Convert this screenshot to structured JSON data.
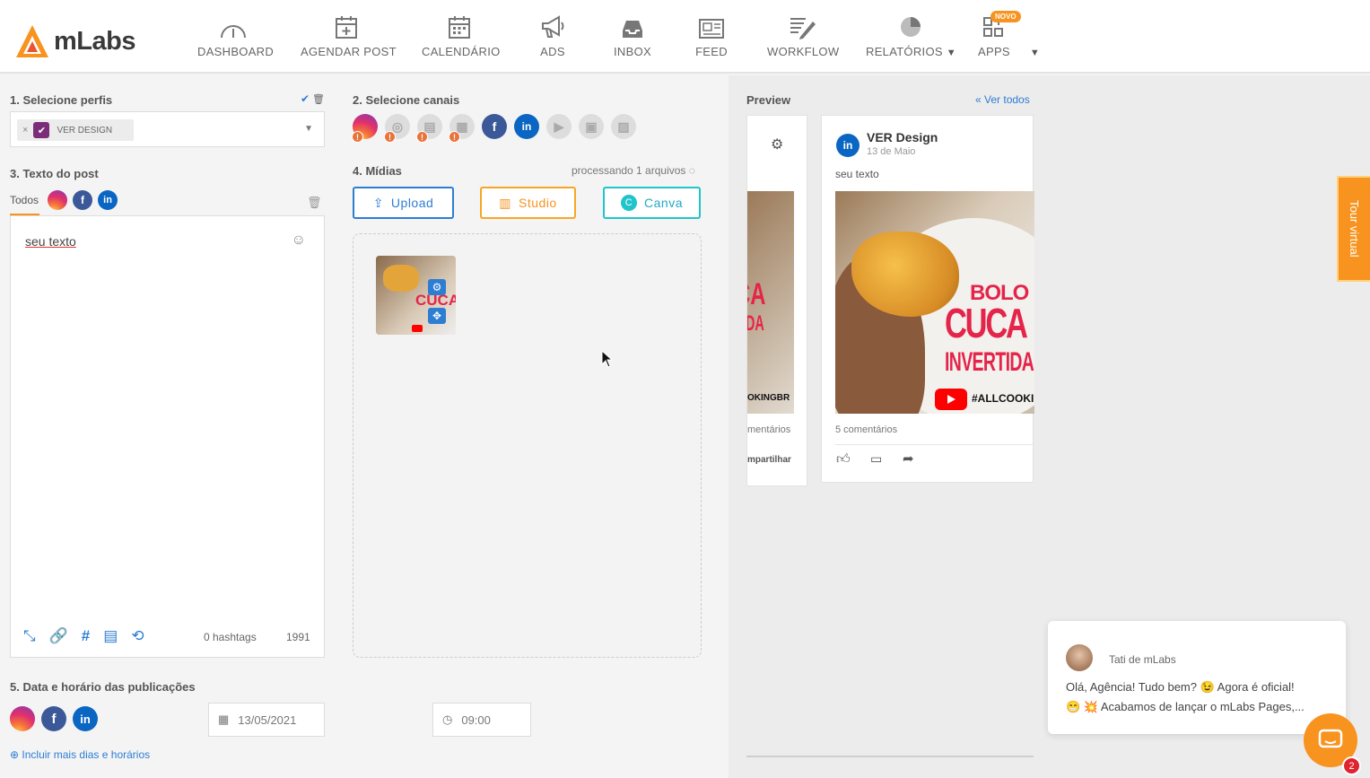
{
  "app": {
    "brand": "mLabs",
    "accent": "#f7931e",
    "link_color": "#2d7dd2"
  },
  "nav": [
    {
      "label": "DASHBOARD",
      "icon": "gauge-icon"
    },
    {
      "label": "AGENDAR POST",
      "icon": "calendar-plus-icon"
    },
    {
      "label": "CALENDÁRIO",
      "icon": "calendar-icon"
    },
    {
      "label": "ADS",
      "icon": "megaphone-icon"
    },
    {
      "label": "INBOX",
      "icon": "inbox-icon"
    },
    {
      "label": "FEED",
      "icon": "feed-icon"
    },
    {
      "label": "WORKFLOW",
      "icon": "workflow-icon"
    },
    {
      "label": "RELATÓRIOS",
      "icon": "pie-chart-icon"
    },
    {
      "label": "APPS",
      "icon": "apps-icon",
      "badge": "NOVO"
    }
  ],
  "profiles": {
    "title": "1. Selecione perfis",
    "selected": "VER DESIGN"
  },
  "post_text": {
    "title": "3. Texto do post",
    "tab_all": "Todos",
    "value": "seu texto",
    "hashtags": "0 hashtags",
    "char_count": "1991"
  },
  "channels": {
    "title": "2. Selecione canais",
    "list": [
      "instagram",
      "instagram-stories",
      "google-my-business",
      "pinterest",
      "facebook",
      "linkedin",
      "youtube",
      "tiktok",
      "image"
    ]
  },
  "media": {
    "title": "4. Mídias",
    "status": "processando 1 arquivos",
    "upload": "Upload",
    "studio": "Studio",
    "canva": "Canva"
  },
  "schedule": {
    "title": "5. Data e horário das publicações",
    "date": "13/05/2021",
    "time": "09:00",
    "add_more": "Incluir mais dias e horários"
  },
  "preview": {
    "title": "Preview",
    "see_all": "Ver todos",
    "page_name": "VER Design",
    "date": "13 de Maio",
    "text": "seu texto",
    "image_text": {
      "line1": "BOLO",
      "line2": "CUCA",
      "line3": "INVERTIDA",
      "tag": "#ALLCOOKING"
    },
    "comments": "5 comentários",
    "side_comments": "mentários",
    "side_share": "mpartilhar",
    "side_tag": "OKINGBR",
    "side_line2": "CA",
    "side_line3": "IDA"
  },
  "tour": {
    "label": "Tour virtual"
  },
  "chat": {
    "agent": "Tati",
    "agent_suffix": "de mLabs",
    "line1": "Olá, Agência! Tudo bem? 😉  Agora é oficial!",
    "line2": "😁 💥 Acabamos de lançar o mLabs Pages,...",
    "unread": "2"
  }
}
